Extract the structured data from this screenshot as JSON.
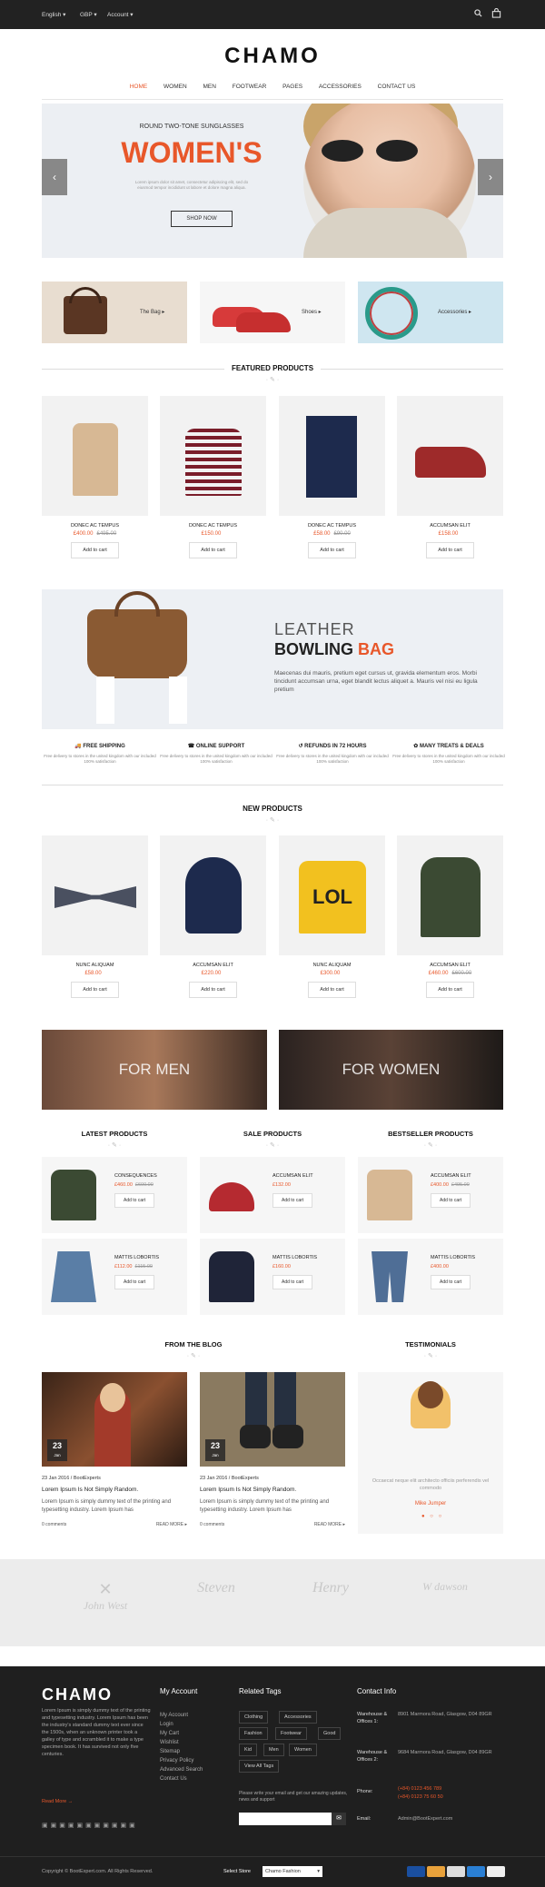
{
  "topbar": {
    "language": "English",
    "currency": "GBP",
    "account": "Account"
  },
  "logo": "CHAMO",
  "nav": [
    "HOME",
    "WOMEN",
    "MEN",
    "FOOTWEAR",
    "PAGES",
    "ACCESSORIES",
    "CONTACT US"
  ],
  "hero": {
    "subtitle": "ROUND TWO-TONE SUNGLASSES",
    "title": "WOMEN'S",
    "body": "Lorem ipsum dolor sit amet, consectetur adipiscing elit, sed do eiusmod tempor incididunt ut labore et dolore magna aliqua.",
    "button": "SHOP NOW",
    "prev": "‹",
    "next": "›"
  },
  "promo": {
    "bag": "The Bag ▸",
    "shoes": "Shoes ▸",
    "accessories": "Accessories ▸"
  },
  "featured": {
    "title": "FEATURED PRODUCTS",
    "items": [
      {
        "name": "DONEC AC TEMPUS",
        "price": "£400.00",
        "old": "£495.00"
      },
      {
        "name": "DONEC AC TEMPUS",
        "price": "£150.00",
        "old": ""
      },
      {
        "name": "DONEC AC TEMPUS",
        "price": "£58.00",
        "old": "£90.00"
      },
      {
        "name": "ACCUMSAN ELIT",
        "price": "£158.00",
        "old": ""
      }
    ],
    "cart": "Add to cart"
  },
  "leather": {
    "line1": "LEATHER",
    "line2a": "BOWLING",
    "line2b": "BAG",
    "body": "Maecenas dui mauris, pretium eget cursus ut, gravida elementum eros. Morbi tincidunt accumsan urna, eget blandit lectus aliquet a. Mauris vel nisi eu ligula pretium"
  },
  "features": [
    {
      "title": "FREE SHIPPING",
      "text": "Free delivery to stores in the united kingdom with our included 100% satisfaction"
    },
    {
      "title": "ONLINE SUPPORT",
      "text": "Free delivery to stores in the united kingdom with our included 100% satisfaction"
    },
    {
      "title": "REFUNDS IN 72 HOURS",
      "text": "Free delivery to stores in the united kingdom with our included 100% satisfaction"
    },
    {
      "title": "MANY TREATS & DEALS",
      "text": "Free delivery to stores in the united kingdom with our included 100% satisfaction"
    }
  ],
  "newp": {
    "title": "NEW PRODUCTS",
    "items": [
      {
        "name": "NUNC ALIQUAM",
        "price": "£58.00",
        "old": ""
      },
      {
        "name": "ACCUMSAN ELIT",
        "price": "£220.00",
        "old": ""
      },
      {
        "name": "NUNC ALIQUAM",
        "price": "£300.00",
        "old": ""
      },
      {
        "name": "ACCUMSAN ELIT",
        "price": "£460.00",
        "old": "£600.00"
      }
    ]
  },
  "genders": {
    "men": "FOR MEN",
    "women": "FOR WOMEN"
  },
  "lists": {
    "latest": {
      "title": "LATEST PRODUCTS",
      "items": [
        {
          "name": "CONSEQUENCES",
          "price": "£460.00",
          "old": "£600.00"
        },
        {
          "name": "MATTIS LOBORTIS",
          "price": "£112.00",
          "old": "£115.00"
        }
      ]
    },
    "sale": {
      "title": "SALE PRODUCTS",
      "items": [
        {
          "name": "ACCUMSAN ELIT",
          "price": "£132.00",
          "old": ""
        },
        {
          "name": "MATTIS LOBORTIS",
          "price": "£160.00",
          "old": ""
        }
      ]
    },
    "best": {
      "title": "BESTSELLER PRODUCTS",
      "items": [
        {
          "name": "ACCUMSAN ELIT",
          "price": "£400.00",
          "old": "£495.00"
        },
        {
          "name": "MATTIS LOBORTIS",
          "price": "£400.00",
          "old": ""
        }
      ]
    }
  },
  "blog": {
    "title": "FROM THE BLOG",
    "posts": [
      {
        "day": "23",
        "mon": "Jan",
        "meta": "23 Jan 2016 / BootExperts",
        "title": "Lorem Ipsum Is Not Simply Random.",
        "excerpt": "Lorem Ipsum is simply dummy text of the printing and typesetting industry. Lorem Ipsum has",
        "comments": "0 comments",
        "more": "READ MORE"
      },
      {
        "day": "23",
        "mon": "Jan",
        "meta": "23 Jan 2016 / BootExperts",
        "title": "Lorem Ipsum Is Not Simply Random.",
        "excerpt": "Lorem Ipsum is simply dummy text of the printing and typesetting industry. Lorem Ipsum has",
        "comments": "0 comments",
        "more": "READ MORE"
      }
    ]
  },
  "testimonials": {
    "title": "TESTIMONIALS",
    "quote": "Occaecat neque elit architecto officiis perferendis vel commodo",
    "author": "Mike Jumper"
  },
  "brandnames": [
    "John West",
    "Steven",
    "Henry",
    "W dawson"
  ],
  "footer": {
    "logo": "CHAMO",
    "about": "Lorem Ipsum is simply dummy text of the printing and typesetting industry. Lorem Ipsum has been the industry's standard dummy text ever since the 1500s, when an unknown printer took a galley of type and scrambled it to make a type specimen book. It has survived not only five centuries.",
    "readmore": "Read More →",
    "account_title": "My Account",
    "account": [
      "My Account",
      "Login",
      "My Cart",
      "Wishlist",
      "Sitemap",
      "Privacy Policy",
      "Advanced Search",
      "Contact Us"
    ],
    "tags_title": "Related Tags",
    "tags": [
      "Clothing",
      "Accessories",
      "Fashion",
      "Footwear",
      "Good",
      "Kid",
      "Men",
      "Women",
      "View All Tags"
    ],
    "newsletter": "Please write your email and get our amazing updates, news and support",
    "contact_title": "Contact Info",
    "wh1_label": "Warehouse & Offices 1:",
    "wh1": "8901 Marmora Road, Glasgow, D04 89GR",
    "wh2_label": "Warehouse & Offices 2:",
    "wh2": "9684 Marmora Road, Glasgow, D04 89GR",
    "phone_label": "Phone:",
    "phone1": "(+84) 0123 456 789",
    "phone2": "(+84) 0123 75 60 50",
    "email_label": "Email:",
    "email": "Admin@BootExpert.com",
    "copyright": "Copyright © BootExpert.com. All Rights Reserved.",
    "store_label": "Select Store",
    "store": "Chamo Fashion"
  },
  "colors": {
    "accent": "#e8572a",
    "dark": "#1f1f1f"
  }
}
